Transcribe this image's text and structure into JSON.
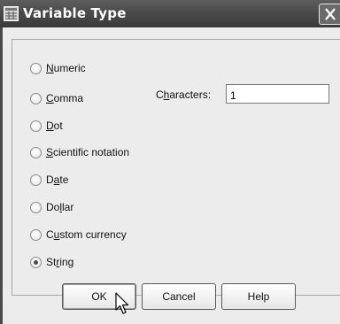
{
  "window": {
    "title": "Variable Type",
    "app_icon": "grid-icon",
    "close_icon": "close-x-icon"
  },
  "options": [
    {
      "id": "numeric",
      "pre": "",
      "key": "N",
      "post": "umeric",
      "checked": false
    },
    {
      "id": "comma",
      "pre": "",
      "key": "C",
      "post": "omma",
      "checked": false
    },
    {
      "id": "dot",
      "pre": "",
      "key": "D",
      "post": "ot",
      "checked": false
    },
    {
      "id": "scientific-notation",
      "pre": "",
      "key": "S",
      "post": "cientific notation",
      "checked": false
    },
    {
      "id": "date",
      "pre": "D",
      "key": "a",
      "post": "te",
      "checked": false
    },
    {
      "id": "dollar",
      "pre": "Do",
      "key": "l",
      "post": "lar",
      "checked": false
    },
    {
      "id": "custom-currency",
      "pre": "C",
      "key": "u",
      "post": "stom currency",
      "checked": false
    },
    {
      "id": "string",
      "pre": "St",
      "key": "r",
      "post": "ing",
      "checked": true
    }
  ],
  "characters": {
    "label_pre": "C",
    "label_key": "h",
    "label_post": "aracters:",
    "value": "1"
  },
  "buttons": {
    "ok": "OK",
    "cancel": "Cancel",
    "help": "Help"
  },
  "cursor_icon": "mouse-pointer-icon"
}
